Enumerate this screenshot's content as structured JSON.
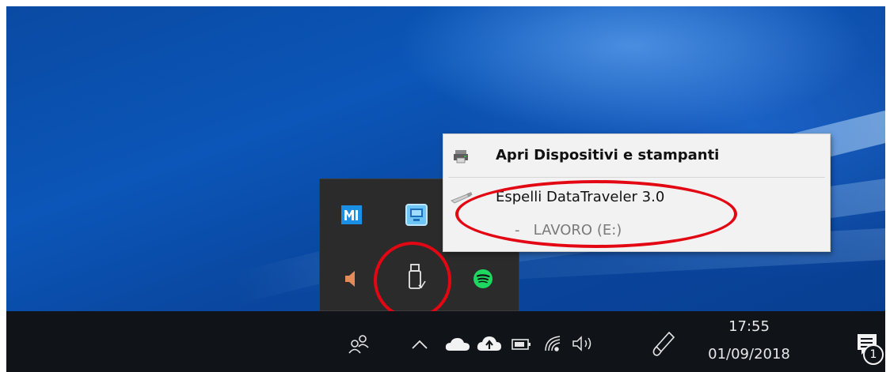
{
  "desktop": {
    "accent": "#0b56b8"
  },
  "context_menu": {
    "items": [
      {
        "label": "Apri Dispositivi e stampanti",
        "bold": true,
        "icon": "devices-printers-icon"
      },
      {
        "label": "Espelli DataTraveler 3.0",
        "icon": "usb-drive-icon"
      }
    ],
    "subitem": "-   LAVORO (E:)"
  },
  "tray_overflow": {
    "icons": [
      "malwarebytes-icon",
      "network-app-icon",
      "volume-muted-icon",
      "safely-remove-usb-icon",
      "spotify-icon"
    ]
  },
  "taskbar": {
    "icons": [
      "people-icon",
      "chevron-up-icon",
      "onedrive-icon",
      "upload-cloud-icon",
      "battery-icon",
      "wifi-icon",
      "volume-icon",
      "pen-icon"
    ],
    "clock": {
      "time": "17:55",
      "date": "01/09/2018"
    },
    "notifications": {
      "count": "1",
      "icon": "action-center-icon"
    }
  },
  "annotations": {
    "color": "#e30613"
  }
}
